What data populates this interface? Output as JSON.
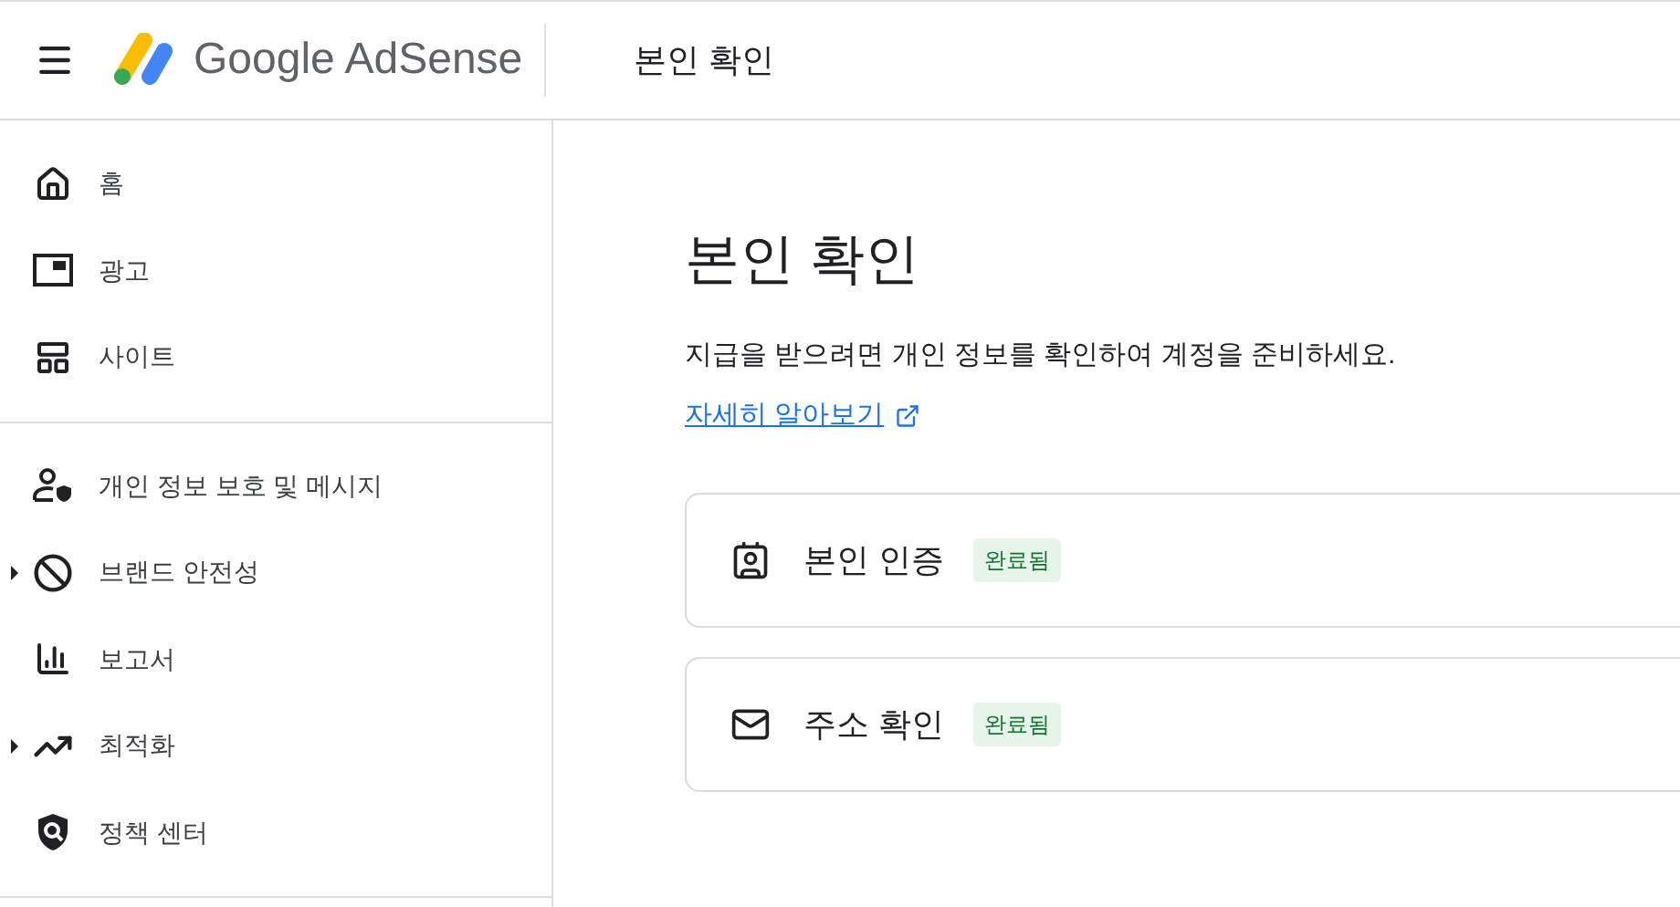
{
  "header": {
    "logo_text": "Google AdSense",
    "title": "본인 확인"
  },
  "sidebar": {
    "groups": [
      {
        "items": [
          {
            "label": "홈",
            "expandable": false
          },
          {
            "label": "광고",
            "expandable": false
          },
          {
            "label": "사이트",
            "expandable": false
          }
        ]
      },
      {
        "items": [
          {
            "label": "개인 정보 보호 및 메시지",
            "expandable": false
          },
          {
            "label": "브랜드 안전성",
            "expandable": true
          },
          {
            "label": "보고서",
            "expandable": false
          },
          {
            "label": "최적화",
            "expandable": true
          },
          {
            "label": "정책 센터",
            "expandable": false
          }
        ]
      }
    ]
  },
  "main": {
    "heading": "본인 확인",
    "description": "지급을 받으려면 개인 정보를 확인하여 계정을 준비하세요.",
    "link": "자세히 알아보기",
    "steps": [
      {
        "title": "본인 인증",
        "status": "완료됨",
        "completed": true
      },
      {
        "title": "주소 확인",
        "status": "완료됨",
        "completed": true
      }
    ]
  }
}
